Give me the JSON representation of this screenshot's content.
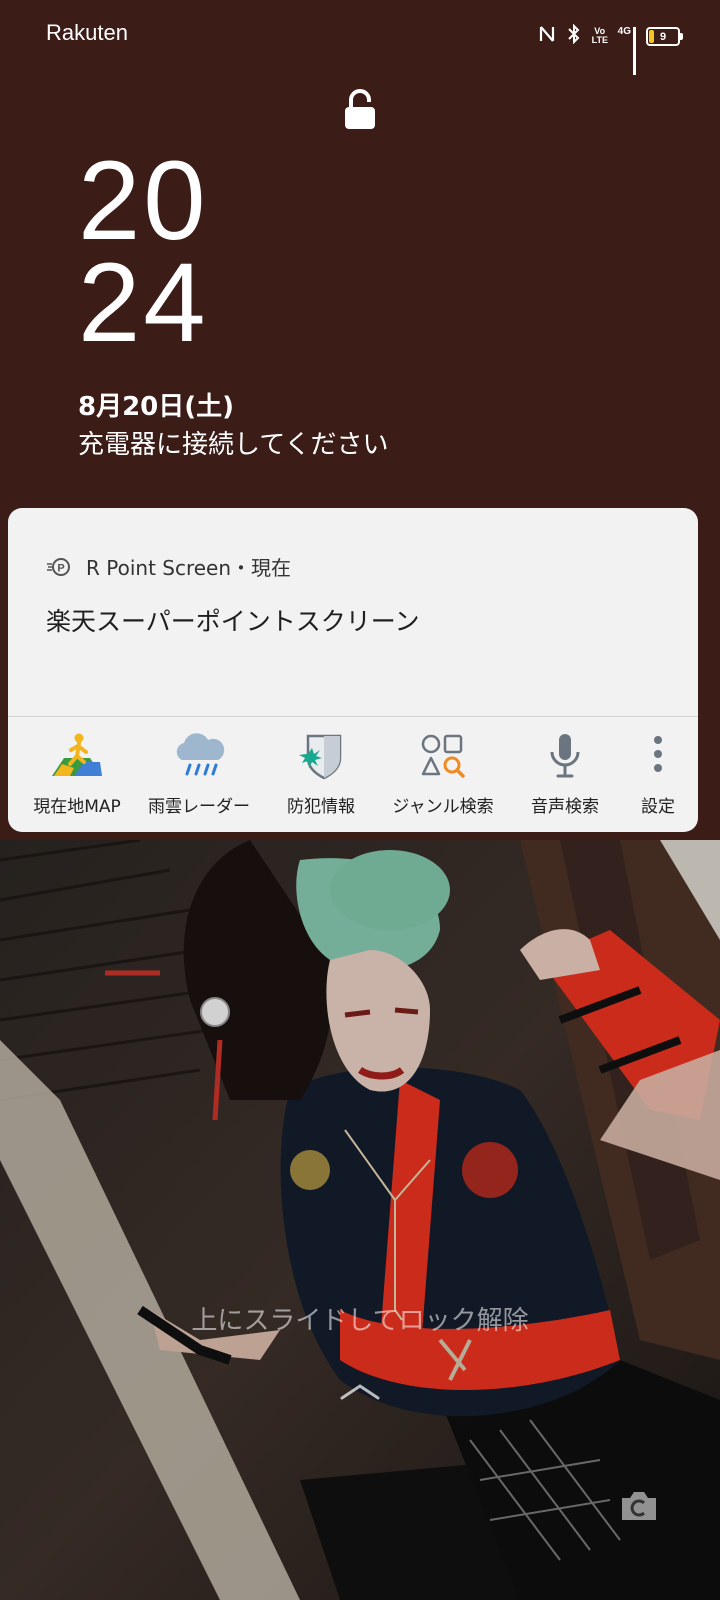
{
  "status_bar": {
    "carrier": "Rakuten",
    "network": "4G",
    "volte_label": "Vo LTE",
    "battery_level": "9",
    "icons": [
      "nfc-icon",
      "bluetooth-icon",
      "volte-icon",
      "signal-4g-icon",
      "battery-icon"
    ]
  },
  "lockscreen": {
    "hour": "20",
    "minute": "24",
    "date": "8月20日(土)",
    "charging_message": "充電器に接続してください",
    "unlock_hint": "上にスライドしてロック解除"
  },
  "notification": {
    "app_icon": "r-point-icon",
    "app_name": "R Point Screen",
    "separator": "・",
    "time": "現在",
    "title": "楽天スーパーポイントスクリーン",
    "actions": [
      {
        "label": "現在地MAP",
        "icon": "map-walker-icon"
      },
      {
        "label": "雨雲レーダー",
        "icon": "rain-cloud-icon"
      },
      {
        "label": "防犯情報",
        "icon": "shield-alert-icon"
      },
      {
        "label": "ジャンル検索",
        "icon": "genre-search-icon"
      },
      {
        "label": "音声検索",
        "icon": "microphone-icon"
      },
      {
        "label": "設定",
        "icon": "more-vertical-icon"
      }
    ]
  },
  "colors": {
    "background": "#3b1c17",
    "card": "#f2f2f2",
    "battery_accent": "#f3c623",
    "rain_blue": "#2f7bd6",
    "shield_teal": "#18a890",
    "search_orange": "#f08a22"
  }
}
